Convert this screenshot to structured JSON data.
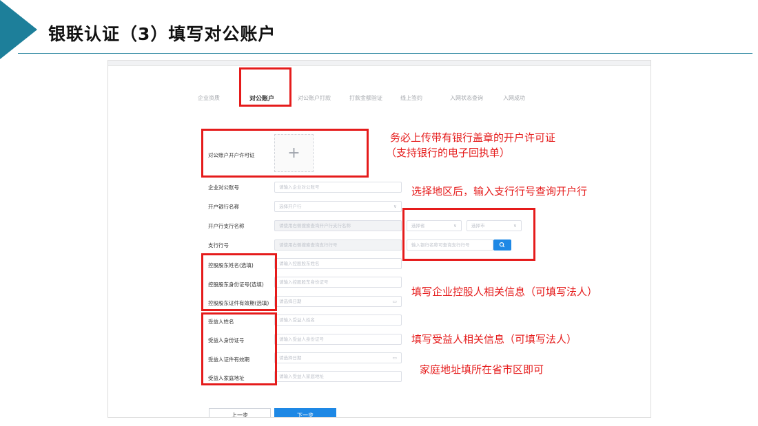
{
  "slide": {
    "title": "银联认证（3）填写对公账户",
    "accent_color": "#1d7f9a",
    "annotation_color": "#e51b1b"
  },
  "steps": [
    {
      "label": "企业资质",
      "active": false
    },
    {
      "label": "对公账户",
      "active": true
    },
    {
      "label": "对公账户打款",
      "active": false
    },
    {
      "label": "打款金额验证",
      "active": false
    },
    {
      "label": "线上签约",
      "active": false
    },
    {
      "label": "入网状态查询",
      "active": false
    },
    {
      "label": "入网成功",
      "active": false
    }
  ],
  "form": {
    "license": {
      "label": "对公账户开户许可证",
      "icon": "plus-icon"
    },
    "account_no": {
      "label": "企业对公账号",
      "placeholder": "请输入企业对公账号"
    },
    "bank_name": {
      "label": "开户银行名称",
      "placeholder": "选择开户行"
    },
    "branch_name": {
      "label": "开户行支行名称",
      "placeholder": "请使用右侧搜索查询开户行支行名称"
    },
    "province": {
      "placeholder": "选择省"
    },
    "city": {
      "placeholder": "选择市"
    },
    "branch_no": {
      "label": "支行行号",
      "placeholder": "请使用右侧搜索查询支行行号"
    },
    "branch_search": {
      "placeholder": "输入银行名称可查询支行行号",
      "icon": "search-icon"
    },
    "holder_name": {
      "label": "控股股东姓名(选填)",
      "placeholder": "请输入控股股东姓名"
    },
    "holder_id": {
      "label": "控股股东身份证号(选填)",
      "placeholder": "请输入控股股东身份证号"
    },
    "holder_expiry": {
      "label": "控股股东证件有效期(选填)",
      "placeholder": "请选择日期",
      "icon": "calendar-icon"
    },
    "beneficiary_name": {
      "label": "受益人姓名",
      "placeholder": "请输入受益人姓名"
    },
    "beneficiary_id": {
      "label": "受益人身份证号",
      "placeholder": "请输入受益人身份证号"
    },
    "beneficiary_expiry": {
      "label": "受益人证件有效期",
      "placeholder": "请选择日期",
      "icon": "calendar-icon"
    },
    "beneficiary_address": {
      "label": "受益人家庭地址",
      "placeholder": "请输入受益人家庭地址"
    }
  },
  "buttons": {
    "prev": "上一步",
    "next": "下一步"
  },
  "notes": {
    "license_line1": "务必上传带有银行盖章的开户许可证",
    "license_line2": "（支持银行的电子回执单）",
    "region": "选择地区后，输入支行行号查询开户行",
    "holder": "填写企业控股人相关信息（可填写法人）",
    "beneficiary": "填写受益人相关信息（可填写法人）",
    "address": "家庭地址填所在省市区即可"
  }
}
